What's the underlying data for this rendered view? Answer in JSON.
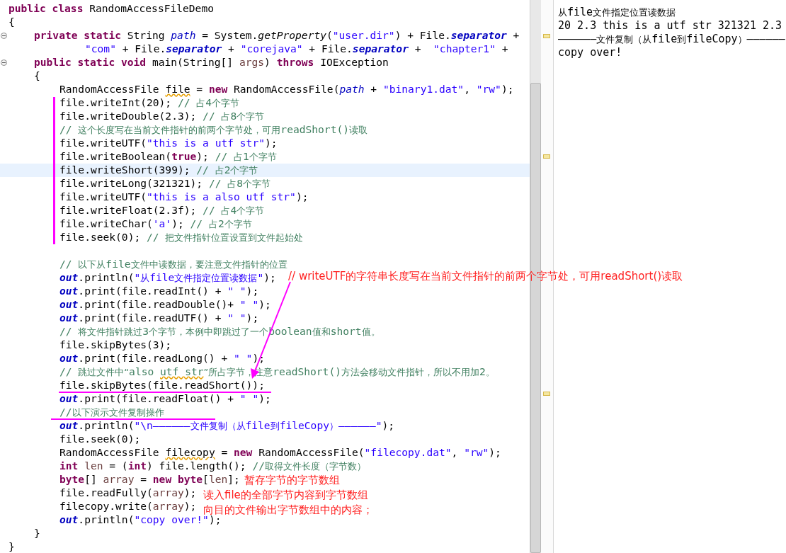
{
  "editor": {
    "lines": [
      {
        "kind": "class",
        "fold": false,
        "current": false,
        "tokens": [
          {
            "kind": "kw",
            "text": "public class "
          },
          {
            "kind": "plain",
            "text": "RandomAccessFileDemo"
          }
        ]
      },
      {
        "kind": "class",
        "fold": false,
        "current": false,
        "tokens": [
          {
            "kind": "plain",
            "text": "{"
          }
        ]
      },
      {
        "kind": "member",
        "fold": true,
        "current": false,
        "tokens": [
          {
            "kind": "kw",
            "text": "private static "
          },
          {
            "kind": "plain",
            "text": "String "
          },
          {
            "kind": "field",
            "text": "path"
          },
          {
            "kind": "plain",
            "text": " = System."
          },
          {
            "kind": "static",
            "text": "getProperty"
          },
          {
            "kind": "plain",
            "text": "("
          },
          {
            "kind": "str",
            "text": "\"user.dir\""
          },
          {
            "kind": "plain",
            "text": ") + File."
          },
          {
            "kind": "const",
            "text": "separator"
          },
          {
            "kind": "plain",
            "text": " +"
          }
        ]
      },
      {
        "kind": "continuation",
        "fold": false,
        "current": false,
        "tokens": [
          {
            "kind": "str",
            "text": "\"com\""
          },
          {
            "kind": "plain",
            "text": " + File."
          },
          {
            "kind": "const",
            "text": "separator"
          },
          {
            "kind": "plain",
            "text": " + "
          },
          {
            "kind": "str",
            "text": "\"corejava\""
          },
          {
            "kind": "plain",
            "text": " + File."
          },
          {
            "kind": "const",
            "text": "separator"
          },
          {
            "kind": "plain",
            "text": " +  "
          },
          {
            "kind": "str",
            "text": "\"chapter1\""
          },
          {
            "kind": "plain",
            "text": " +"
          }
        ]
      },
      {
        "kind": "member",
        "fold": true,
        "current": false,
        "tokens": [
          {
            "kind": "kw",
            "text": "public static void "
          },
          {
            "kind": "plain",
            "text": "main(String[] "
          },
          {
            "kind": "var",
            "text": "args"
          },
          {
            "kind": "plain",
            "text": ") "
          },
          {
            "kind": "kw",
            "text": "throws "
          },
          {
            "kind": "plain",
            "text": "IOException"
          }
        ]
      },
      {
        "kind": "member",
        "fold": false,
        "current": false,
        "tokens": [
          {
            "kind": "plain",
            "text": "{"
          }
        ]
      },
      {
        "kind": "body",
        "fold": false,
        "current": false,
        "tokens": [
          {
            "kind": "plain",
            "text": "RandomAccessFile "
          },
          {
            "kind": "warn",
            "text": "file"
          },
          {
            "kind": "plain",
            "text": " = "
          },
          {
            "kind": "kw",
            "text": "new "
          },
          {
            "kind": "plain",
            "text": "RandomAccessFile("
          },
          {
            "kind": "field",
            "text": "path"
          },
          {
            "kind": "plain",
            "text": " + "
          },
          {
            "kind": "str",
            "text": "\"binary1.dat\""
          },
          {
            "kind": "plain",
            "text": ", "
          },
          {
            "kind": "str",
            "text": "\"rw\""
          },
          {
            "kind": "plain",
            "text": ");"
          }
        ]
      },
      {
        "kind": "body",
        "fold": false,
        "current": false,
        "tokens": [
          {
            "kind": "plain",
            "text": "file.writeInt(20); "
          },
          {
            "kind": "comment",
            "text": "// 占4个字节"
          }
        ]
      },
      {
        "kind": "body",
        "fold": false,
        "current": false,
        "tokens": [
          {
            "kind": "plain",
            "text": "file.writeDouble(2.3); "
          },
          {
            "kind": "comment",
            "text": "// 占8个字节"
          }
        ]
      },
      {
        "kind": "body",
        "fold": false,
        "current": false,
        "tokens": [
          {
            "kind": "comment",
            "text": "// 这个长度写在当前文件指针的前两个字节处，可用readShort()读取"
          }
        ]
      },
      {
        "kind": "body",
        "fold": false,
        "current": false,
        "tokens": [
          {
            "kind": "plain",
            "text": "file.writeUTF("
          },
          {
            "kind": "str",
            "text": "\"this is a utf str\""
          },
          {
            "kind": "plain",
            "text": ");"
          }
        ]
      },
      {
        "kind": "body",
        "fold": false,
        "current": false,
        "tokens": [
          {
            "kind": "plain",
            "text": "file.writeBoolean("
          },
          {
            "kind": "kw",
            "text": "true"
          },
          {
            "kind": "plain",
            "text": "); "
          },
          {
            "kind": "comment",
            "text": "// 占1个字节"
          }
        ]
      },
      {
        "kind": "body",
        "fold": false,
        "current": true,
        "tokens": [
          {
            "kind": "plain",
            "text": "file.writeShort(399); "
          },
          {
            "kind": "comment",
            "text": "// 占2个字节"
          }
        ]
      },
      {
        "kind": "body",
        "fold": false,
        "current": false,
        "tokens": [
          {
            "kind": "plain",
            "text": "file.writeLong(321321); "
          },
          {
            "kind": "comment",
            "text": "// 占8个字节"
          }
        ]
      },
      {
        "kind": "body",
        "fold": false,
        "current": false,
        "tokens": [
          {
            "kind": "plain",
            "text": "file.writeUTF("
          },
          {
            "kind": "str",
            "text": "\"this is a also utf str\""
          },
          {
            "kind": "plain",
            "text": ");"
          }
        ]
      },
      {
        "kind": "body",
        "fold": false,
        "current": false,
        "tokens": [
          {
            "kind": "plain",
            "text": "file.writeFloat(2.3f); "
          },
          {
            "kind": "comment",
            "text": "// 占4个字节"
          }
        ]
      },
      {
        "kind": "body",
        "fold": false,
        "current": false,
        "tokens": [
          {
            "kind": "plain",
            "text": "file.writeChar("
          },
          {
            "kind": "str",
            "text": "'a'"
          },
          {
            "kind": "plain",
            "text": "); "
          },
          {
            "kind": "comment",
            "text": "// 占2个字节"
          }
        ]
      },
      {
        "kind": "body",
        "fold": false,
        "current": false,
        "tokens": [
          {
            "kind": "plain",
            "text": "file.seek(0); "
          },
          {
            "kind": "comment",
            "text": "// 把文件指针位置设置到文件起始处"
          }
        ]
      },
      {
        "kind": "blank",
        "fold": false,
        "current": false
      },
      {
        "kind": "body",
        "fold": false,
        "current": false,
        "tokens": [
          {
            "kind": "comment",
            "text": "// 以下从file文件中读数据，要注意文件指针的位置"
          }
        ]
      },
      {
        "kind": "body",
        "fold": false,
        "current": false,
        "tokens": [
          {
            "kind": "const",
            "text": "out"
          },
          {
            "kind": "plain",
            "text": ".println("
          },
          {
            "kind": "str",
            "text": "\"从file文件指定位置读数据\""
          },
          {
            "kind": "plain",
            "text": ");"
          }
        ]
      },
      {
        "kind": "body",
        "fold": false,
        "current": false,
        "tokens": [
          {
            "kind": "const",
            "text": "out"
          },
          {
            "kind": "plain",
            "text": ".print(file.readInt() + "
          },
          {
            "kind": "str",
            "text": "\" \""
          },
          {
            "kind": "plain",
            "text": ");"
          }
        ]
      },
      {
        "kind": "body",
        "fold": false,
        "current": false,
        "tokens": [
          {
            "kind": "const",
            "text": "out"
          },
          {
            "kind": "plain",
            "text": ".print(file.readDouble()+ "
          },
          {
            "kind": "str",
            "text": "\" \""
          },
          {
            "kind": "plain",
            "text": ");"
          }
        ]
      },
      {
        "kind": "body",
        "fold": false,
        "current": false,
        "tokens": [
          {
            "kind": "const",
            "text": "out"
          },
          {
            "kind": "plain",
            "text": ".print(file.readUTF() + "
          },
          {
            "kind": "str",
            "text": "\" \""
          },
          {
            "kind": "plain",
            "text": ");"
          }
        ]
      },
      {
        "kind": "body",
        "fold": false,
        "current": false,
        "tokens": [
          {
            "kind": "comment",
            "text": "// 将文件指针跳过3个字节，本例中即跳过了一个boolean值和short值。"
          }
        ]
      },
      {
        "kind": "body",
        "fold": false,
        "current": false,
        "tokens": [
          {
            "kind": "plain",
            "text": "file.skipBytes(3);"
          }
        ]
      },
      {
        "kind": "body",
        "fold": false,
        "current": false,
        "tokens": [
          {
            "kind": "const",
            "text": "out"
          },
          {
            "kind": "plain",
            "text": ".print(file.readLong() + "
          },
          {
            "kind": "str",
            "text": "\" \""
          },
          {
            "kind": "plain",
            "text": ");"
          }
        ]
      },
      {
        "kind": "body",
        "fold": false,
        "current": false,
        "tokens": [
          {
            "kind": "comment",
            "text": "// 跳过文件中“also "
          },
          {
            "kind": "commentwarn",
            "text": "utf str"
          },
          {
            "kind": "comment",
            "text": "”所占字节，注意readShort()方法会移动文件指针，所以不用加2。"
          }
        ]
      },
      {
        "kind": "body",
        "fold": false,
        "current": false,
        "tokens": [
          {
            "kind": "plain",
            "text": "file.skipBytes(file.readShort());"
          }
        ]
      },
      {
        "kind": "body",
        "fold": false,
        "current": false,
        "tokens": [
          {
            "kind": "const",
            "text": "out"
          },
          {
            "kind": "plain",
            "text": ".print(file.readFloat() + "
          },
          {
            "kind": "str",
            "text": "\" \""
          },
          {
            "kind": "plain",
            "text": ");"
          }
        ]
      },
      {
        "kind": "body",
        "fold": false,
        "current": false,
        "tokens": [
          {
            "kind": "comment",
            "text": "//以下演示文件复制操作"
          }
        ]
      },
      {
        "kind": "body",
        "fold": false,
        "current": false,
        "tokens": [
          {
            "kind": "const",
            "text": "out"
          },
          {
            "kind": "plain",
            "text": ".println("
          },
          {
            "kind": "str",
            "text": "\"\\n——————文件复制（从file到fileCopy）——————\""
          },
          {
            "kind": "plain",
            "text": ");"
          }
        ]
      },
      {
        "kind": "body",
        "fold": false,
        "current": false,
        "tokens": [
          {
            "kind": "plain",
            "text": "file.seek(0);"
          }
        ]
      },
      {
        "kind": "body",
        "fold": false,
        "current": false,
        "tokens": [
          {
            "kind": "plain",
            "text": "RandomAccessFile "
          },
          {
            "kind": "warn",
            "text": "filecopy"
          },
          {
            "kind": "plain",
            "text": " = "
          },
          {
            "kind": "kw",
            "text": "new "
          },
          {
            "kind": "plain",
            "text": "RandomAccessFile("
          },
          {
            "kind": "str",
            "text": "\"filecopy.dat\""
          },
          {
            "kind": "plain",
            "text": ", "
          },
          {
            "kind": "str",
            "text": "\"rw\""
          },
          {
            "kind": "plain",
            "text": ");"
          }
        ]
      },
      {
        "kind": "body",
        "fold": false,
        "current": false,
        "tokens": [
          {
            "kind": "kw",
            "text": "int "
          },
          {
            "kind": "var",
            "text": "len"
          },
          {
            "kind": "plain",
            "text": " = ("
          },
          {
            "kind": "kw",
            "text": "int"
          },
          {
            "kind": "plain",
            "text": ") file.length(); "
          },
          {
            "kind": "comment",
            "text": "//取得文件长度（字节数）"
          }
        ]
      },
      {
        "kind": "body",
        "fold": false,
        "current": false,
        "tokens": [
          {
            "kind": "kw",
            "text": "byte"
          },
          {
            "kind": "plain",
            "text": "[] "
          },
          {
            "kind": "var",
            "text": "array"
          },
          {
            "kind": "plain",
            "text": " = "
          },
          {
            "kind": "kw",
            "text": "new byte"
          },
          {
            "kind": "plain",
            "text": "["
          },
          {
            "kind": "var",
            "text": "len"
          },
          {
            "kind": "plain",
            "text": "];"
          }
        ]
      },
      {
        "kind": "body",
        "fold": false,
        "current": false,
        "tokens": [
          {
            "kind": "plain",
            "text": "file.readFully("
          },
          {
            "kind": "var",
            "text": "array"
          },
          {
            "kind": "plain",
            "text": ");"
          }
        ]
      },
      {
        "kind": "body",
        "fold": false,
        "current": false,
        "tokens": [
          {
            "kind": "plain",
            "text": "filecopy.write("
          },
          {
            "kind": "var",
            "text": "array"
          },
          {
            "kind": "plain",
            "text": ");"
          }
        ]
      },
      {
        "kind": "body",
        "fold": false,
        "current": false,
        "tokens": [
          {
            "kind": "const",
            "text": "out"
          },
          {
            "kind": "plain",
            "text": ".println("
          },
          {
            "kind": "str",
            "text": "\"copy over!\""
          },
          {
            "kind": "plain",
            "text": ");"
          }
        ]
      },
      {
        "kind": "member",
        "fold": false,
        "current": false,
        "tokens": [
          {
            "kind": "plain",
            "text": "}"
          }
        ]
      },
      {
        "kind": "class",
        "fold": false,
        "current": false,
        "tokens": [
          {
            "kind": "plain",
            "text": "}"
          }
        ]
      }
    ]
  },
  "console": {
    "lines": [
      "从file文件指定位置读数据",
      "20 2.3 this is a utf str 321321 2.3",
      "——————文件复制（从file到fileCopy）——————",
      "copy over!"
    ]
  },
  "annotations": [
    "// writeUTF的字符串长度写在当前文件指针的前两个字节处，可用readShort()读取",
    "暂存字节的字节数组",
    "读入file的全部字节内容到字节数组",
    "向目的文件输出字节数组中的内容；"
  ]
}
